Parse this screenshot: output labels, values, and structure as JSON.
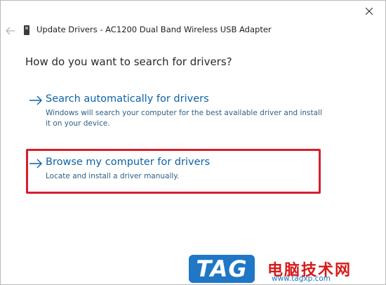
{
  "window": {
    "title": "Update Drivers - AC1200  Dual Band Wireless USB Adapter"
  },
  "main": {
    "question": "How do you want to search for drivers?",
    "options": [
      {
        "title": "Search automatically for drivers",
        "description": "Windows will search your computer for the best available driver and install it on your device."
      },
      {
        "title": "Browse my computer for drivers",
        "description": "Locate and install a driver manually."
      }
    ]
  },
  "watermark": {
    "logo_text": "TAG",
    "site_name_cn": "电脑技术网",
    "url": "www.tagxp.com"
  },
  "icons": {
    "close": "close-icon",
    "back": "back-arrow-icon",
    "device": "usb-device-icon",
    "option_arrow": "arrow-right-icon"
  },
  "colors": {
    "link": "#0b63a8",
    "highlight_border": "#d81e2c",
    "watermark_blue": "#1f77c6",
    "watermark_red": "#d61b1b"
  }
}
